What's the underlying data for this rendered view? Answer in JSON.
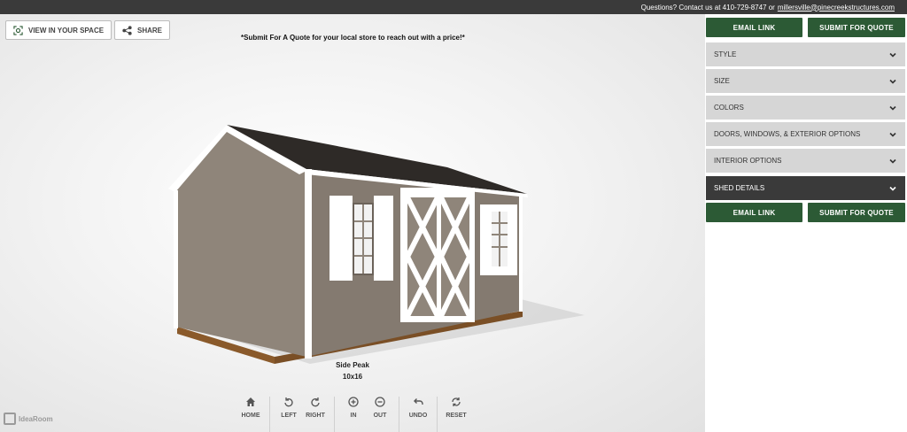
{
  "contact": {
    "prefix": "Questions? Contact us at 410-729-8747 or",
    "email": "millersville@pinecreekstructures.com"
  },
  "toolbar": {
    "view_in_space": "VIEW IN YOUR SPACE",
    "share": "SHARE"
  },
  "notice": "*Submit For A Quote for your local store to reach out with a price!*",
  "caption": {
    "style": "Side Peak",
    "size": "10x16"
  },
  "controls": {
    "home": "HOME",
    "left": "LEFT",
    "right": "RIGHT",
    "in": "IN",
    "out": "OUT",
    "undo": "UNDO",
    "reset": "RESET"
  },
  "logo": "IdeaRoom",
  "sidebar": {
    "email_link": "EMAIL LINK",
    "submit_quote": "SUBMIT FOR QUOTE",
    "sections": [
      "STYLE",
      "SIZE",
      "COLORS",
      "DOORS, WINDOWS, & EXTERIOR OPTIONS",
      "INTERIOR OPTIONS",
      "SHED DETAILS"
    ]
  },
  "colors": {
    "green": "#2c5a35",
    "siding": "#8c8176",
    "roof": "#2e2a27",
    "trim": "#ffffff"
  }
}
